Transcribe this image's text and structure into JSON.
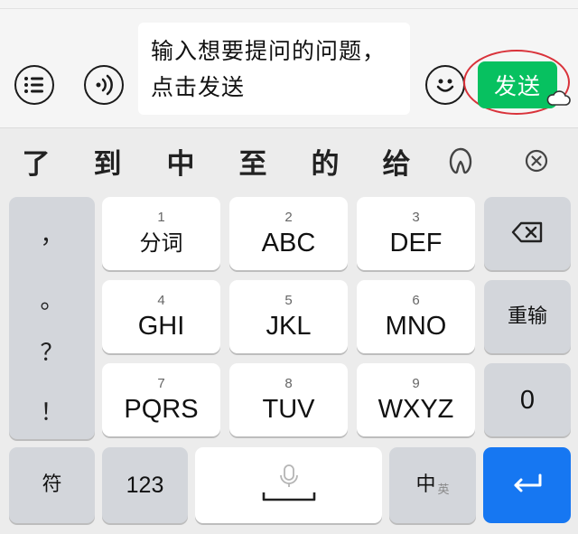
{
  "chat": {
    "message_line1": "输入想要提问的问题，",
    "message_line2": "点击发送",
    "send_label": "发送"
  },
  "candidates": [
    "了",
    "到",
    "中",
    "至",
    "的",
    "给"
  ],
  "keys": {
    "row1": [
      {
        "num": "1",
        "label": "分词"
      },
      {
        "num": "2",
        "label": "ABC"
      },
      {
        "num": "3",
        "label": "DEF"
      }
    ],
    "row2": [
      {
        "num": "4",
        "label": "GHI"
      },
      {
        "num": "5",
        "label": "JKL"
      },
      {
        "num": "6",
        "label": "MNO"
      }
    ],
    "row3": [
      {
        "num": "7",
        "label": "PQRS"
      },
      {
        "num": "8",
        "label": "TUV"
      },
      {
        "num": "9",
        "label": "WXYZ"
      }
    ],
    "reinput": "重输",
    "zero": "0",
    "symbols": "符",
    "numbers": "123",
    "lang_main": "中",
    "lang_alt": "英"
  },
  "punctuation": [
    "，",
    "。",
    "？",
    "！"
  ],
  "colors": {
    "send_green": "#07c160",
    "enter_blue": "#1677f2",
    "highlight_red": "#d9323a"
  },
  "icons": {
    "list": "list-icon",
    "voice": "voice-icon",
    "emoji": "emoji-icon",
    "cloud": "cloud-icon",
    "handwriting": "handwriting-icon",
    "close": "close-icon",
    "backspace": "backspace-icon",
    "microphone": "microphone-icon",
    "enter": "enter-icon"
  }
}
